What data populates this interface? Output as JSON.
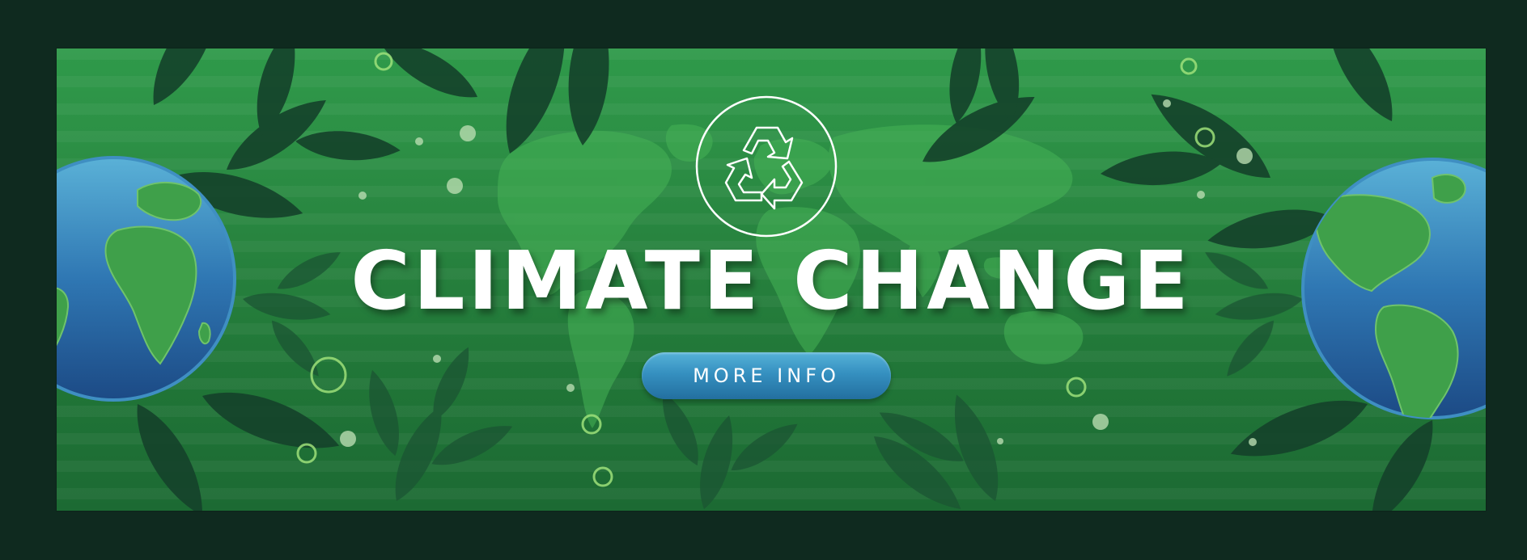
{
  "banner": {
    "title": "CLIMATE CHANGE",
    "button_label": "MORE INFO"
  },
  "icons": {
    "center_badge": "recycle-icon",
    "left_globe": "earth-globe-icon",
    "right_globe": "earth-globe-icon",
    "backdrop": "world-map-icon"
  },
  "colors": {
    "background_outer": "#0f2a1f",
    "banner_green_top": "#2f9a4a",
    "banner_green_bottom": "#1c6a33",
    "leaf_dark": "#14402a",
    "button_blue": "#3590c0",
    "ocean_blue": "#2c6ea8",
    "land_green": "#3fa04a",
    "title_text": "#ffffff"
  }
}
